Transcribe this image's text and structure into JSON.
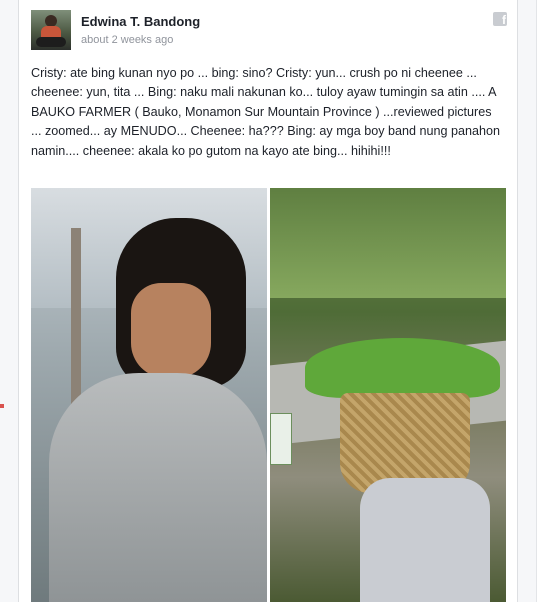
{
  "post": {
    "author": "Edwina T. Bandong",
    "timestamp": "about 2 weeks ago",
    "icon": "facebook-icon",
    "text": "Cristy: ate bing kunan nyo po ... bing: sino? Cristy: yun... crush po ni cheenee ... cheenee: yun, tita ... Bing: naku mali nakunan ko... tuloy ayaw tumingin sa atin .... A BAUKO FARMER ( Bauko, Monamon Sur Mountain Province ) ...reviewed pictures ... zoomed... ay MENUDO... Cheenee: ha??? Bing: ay mga boy band nung panahon namin.... cheenee: akala ko po gutom na kayo ate bing... hihihi!!!"
  },
  "colors": {
    "author": "#1d2129",
    "timestamp": "#90949c",
    "body": "#1d2129"
  }
}
